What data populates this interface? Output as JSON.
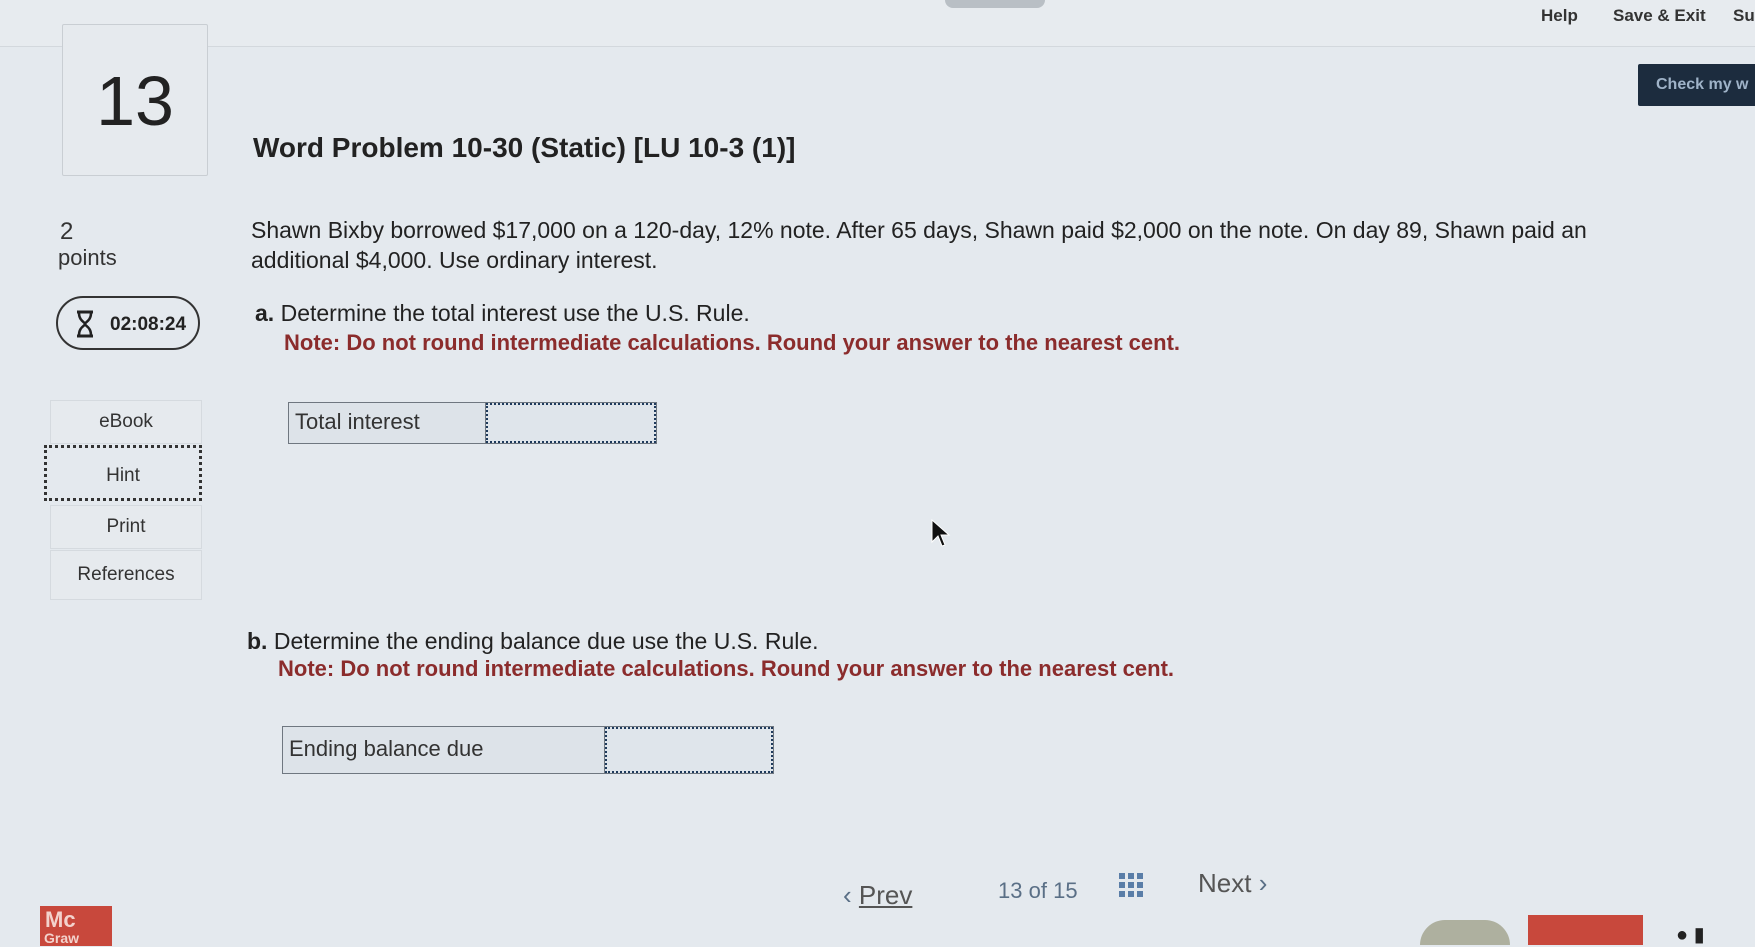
{
  "header": {
    "help_label": "Help",
    "save_exit_label": "Save & Exit",
    "submit_label": "Su",
    "check_label": "Check my w"
  },
  "question": {
    "number": "13",
    "title": "Word Problem 10-30 (Static) [LU 10-3 (1)]",
    "points_value": "2",
    "points_label": "points",
    "timer": "02:08:24",
    "problem_text": "Shawn Bixby borrowed $17,000 on a 120-day, 12% note. After 65 days, Shawn paid $2,000 on the note. On day 89, Shawn paid an additional $4,000. Use ordinary interest.",
    "part_a": {
      "prefix": "a.",
      "prompt": "Determine the total interest use the U.S. Rule.",
      "note": "Note: Do not round intermediate calculations. Round your answer to the nearest cent.",
      "answer_label": "Total interest",
      "answer_value": ""
    },
    "part_b": {
      "prefix": "b.",
      "prompt": "Determine the ending balance due use the U.S. Rule.",
      "note": "Note: Do not round intermediate calculations. Round your answer to the nearest cent.",
      "answer_label": "Ending balance due",
      "answer_value": ""
    }
  },
  "sidebar": {
    "items": [
      {
        "label": "eBook"
      },
      {
        "label": "Hint"
      },
      {
        "label": "Print"
      },
      {
        "label": "References"
      }
    ]
  },
  "navigation": {
    "prev_label": "Prev",
    "current": "13",
    "of_label": "of",
    "total": "15",
    "next_label": "Next"
  },
  "branding": {
    "logo_text": "Mc",
    "logo_sub": "Graw"
  },
  "colors": {
    "background": "#e4e9ee",
    "note_red": "#8b2c2c",
    "check_button": "#1c2c3e",
    "logo_red": "#c8483c"
  },
  "icons": [
    "hourglass-icon",
    "chevron-left-icon",
    "chevron-right-icon",
    "grid-icon",
    "mouse-cursor-icon"
  ]
}
